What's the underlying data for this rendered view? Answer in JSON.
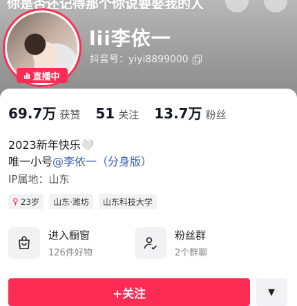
{
  "header": {
    "cutoff_text": "你是否还记得那个你说要娶我的人",
    "name": "lii李依一",
    "douyin_id": "抖音号：yiyi8899000",
    "live_badge": "直播中"
  },
  "stats": [
    {
      "value": "69.7万",
      "label": "获赞"
    },
    {
      "value": "51",
      "label": "关注"
    },
    {
      "value": "13.7万",
      "label": "粉丝"
    }
  ],
  "bio": {
    "line1": "2023新年快乐🤍",
    "line2_prefix": "唯一小号",
    "line2_mention": "@李依一（分身版）",
    "ip": "IP属地：山东"
  },
  "tags": [
    {
      "icon": "female-icon",
      "text": "23岁"
    },
    {
      "text": "山东·潍坊"
    },
    {
      "text": "山东科技大学"
    }
  ],
  "entries": [
    {
      "icon": "shopping-bag-icon",
      "title": "进入橱窗",
      "sub": "126件好物"
    },
    {
      "icon": "fans-group-icon",
      "title": "粉丝群",
      "sub": "2个群聊"
    }
  ],
  "actions": {
    "follow_label": "+关注",
    "more_icon": "caret-down-icon"
  },
  "colors": {
    "accent": "#fe2c55",
    "mention": "#3a5fb2"
  }
}
